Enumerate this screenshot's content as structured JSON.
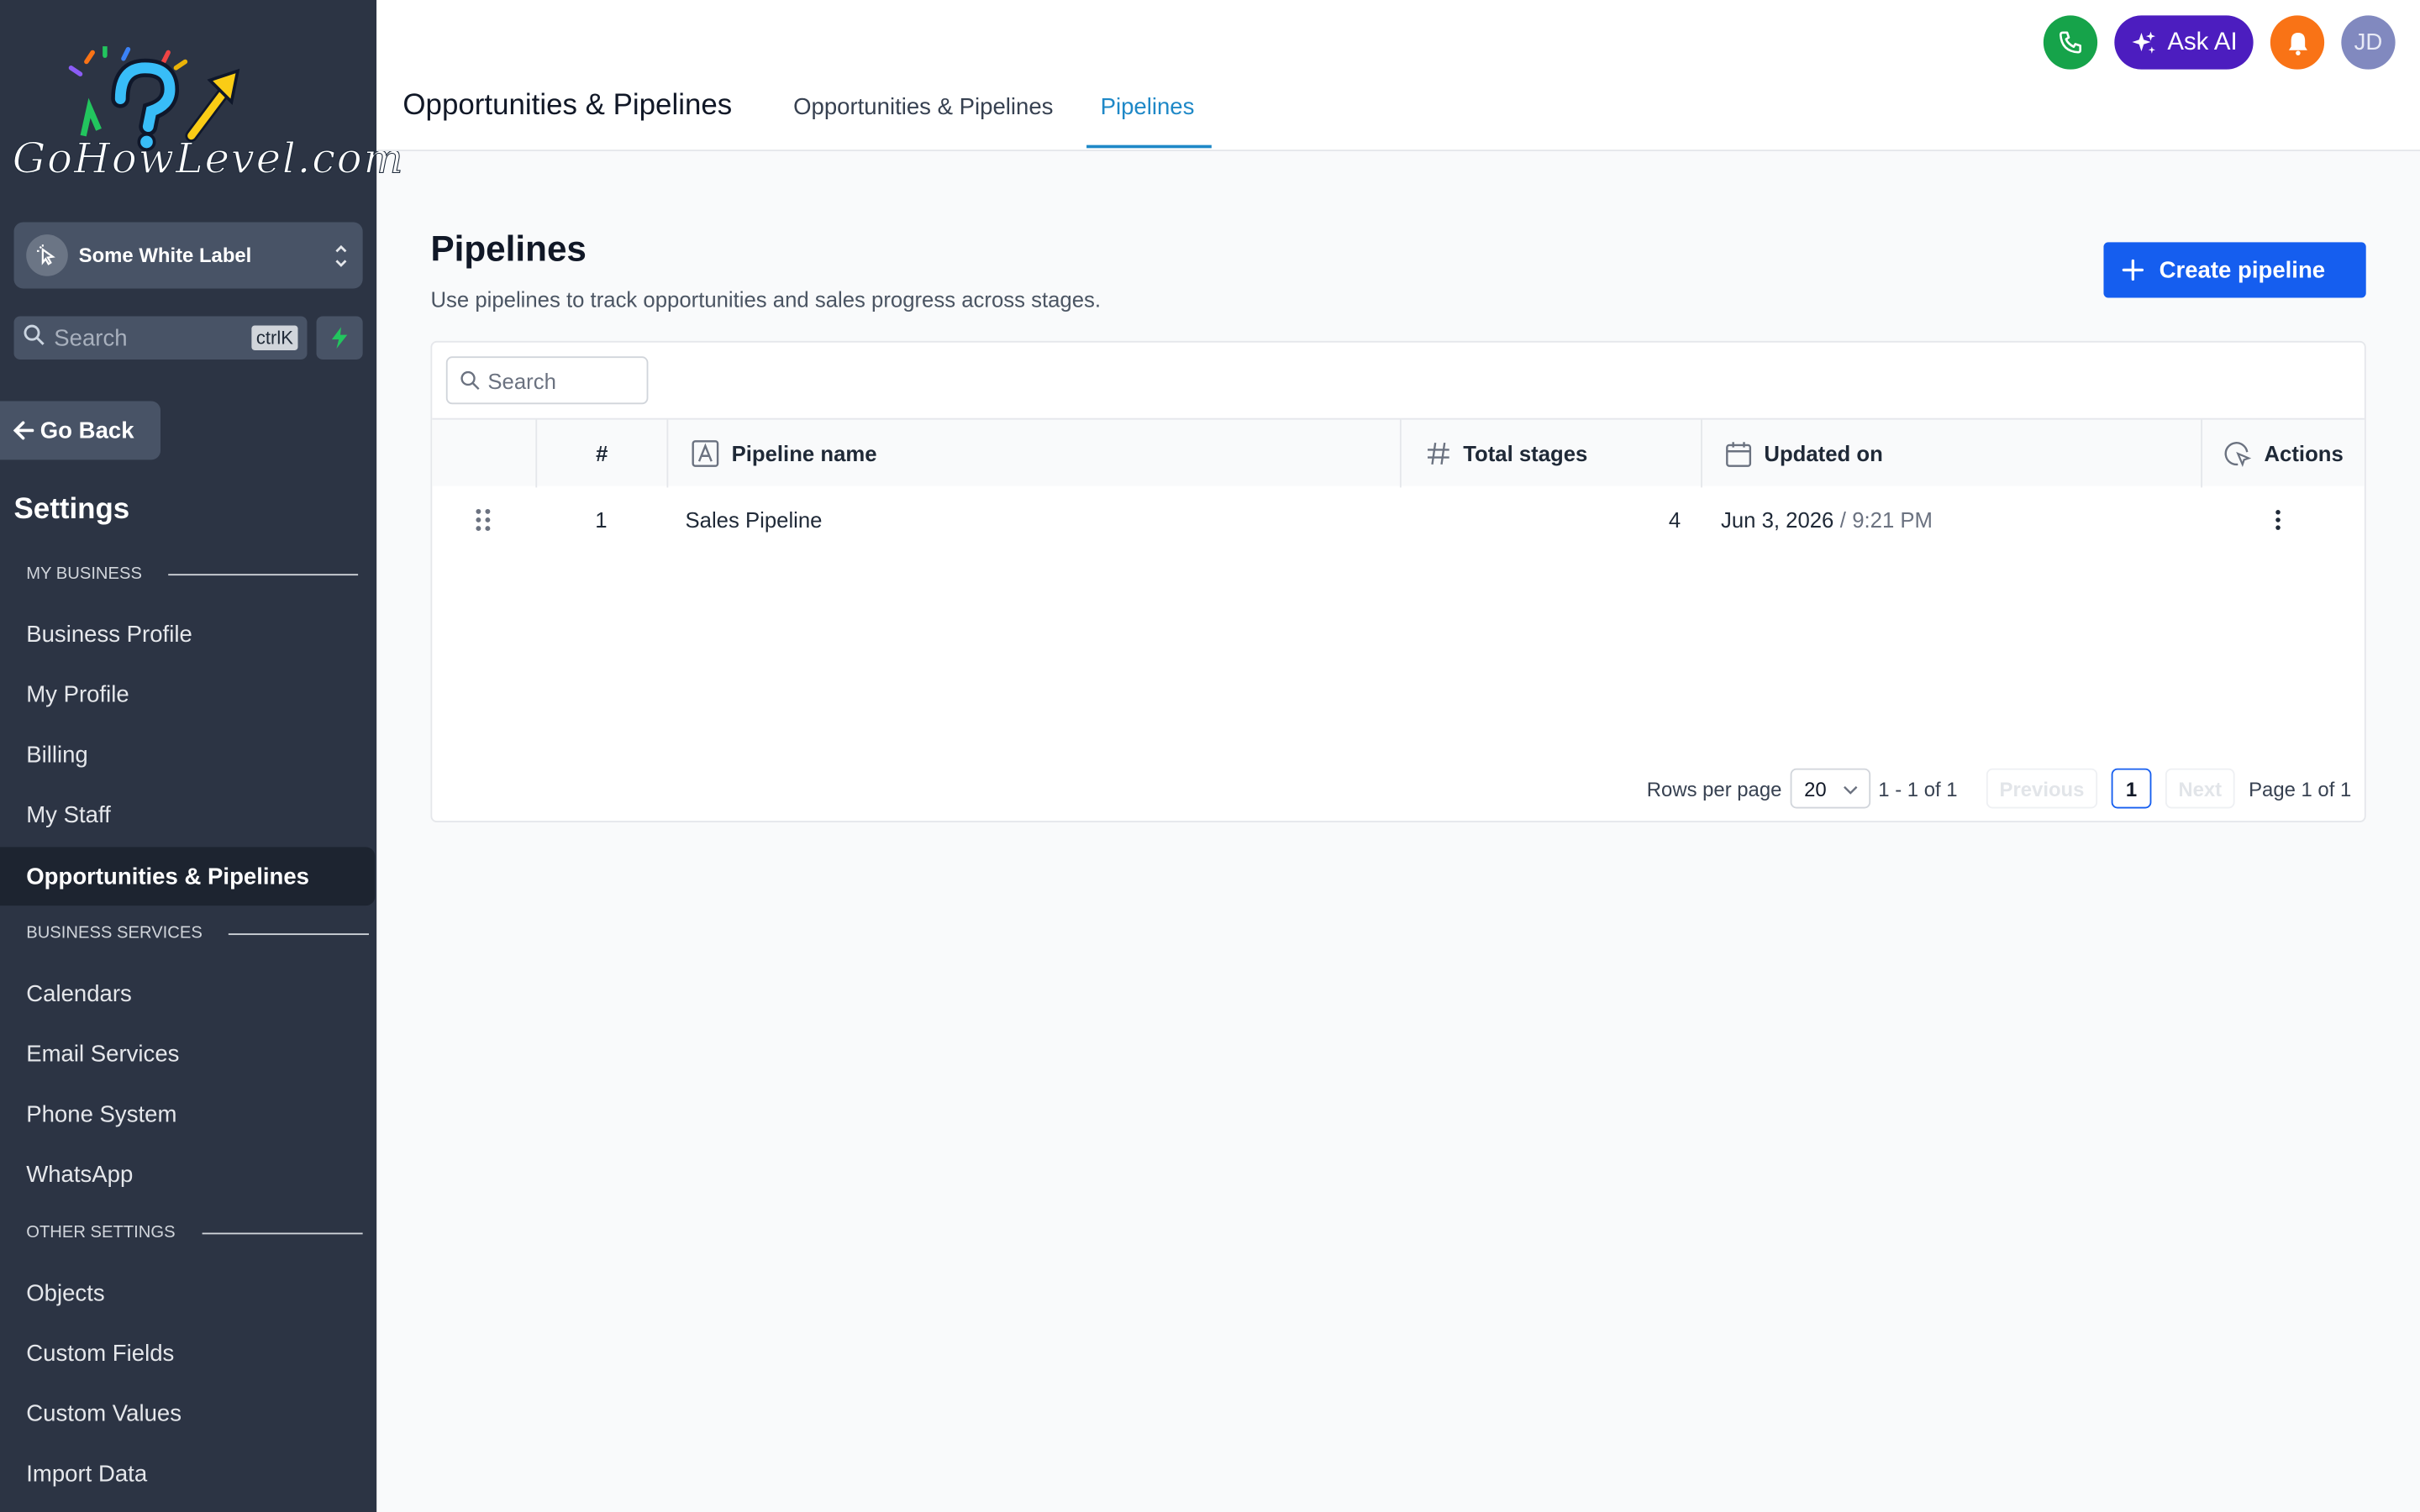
{
  "sidebar": {
    "logo_text": "GoHowLevel.com",
    "account_name": "Some White Label",
    "search_placeholder": "Search",
    "search_shortcut": "ctrlK",
    "go_back": "Go Back",
    "settings_title": "Settings",
    "sections": [
      {
        "header": "MY BUSINESS",
        "items": [
          "Business Profile",
          "My Profile",
          "Billing",
          "My Staff",
          "Opportunities & Pipelines"
        ]
      },
      {
        "header": "BUSINESS SERVICES",
        "items": [
          "Calendars",
          "Email Services",
          "Phone System",
          "WhatsApp"
        ]
      },
      {
        "header": "OTHER SETTINGS",
        "items": [
          "Objects",
          "Custom Fields",
          "Custom Values",
          "Import Data"
        ]
      }
    ],
    "active_item": "Opportunities & Pipelines"
  },
  "header": {
    "title": "Opportunities & Pipelines",
    "tabs": [
      {
        "label": "Opportunities & Pipelines",
        "active": false
      },
      {
        "label": "Pipelines",
        "active": true
      }
    ],
    "ask_ai": "Ask AI",
    "avatar_initials": "JD",
    "icons": [
      "phone-icon",
      "sparkle-icon",
      "bell-icon"
    ]
  },
  "main": {
    "title": "Pipelines",
    "subtitle": "Use pipelines to track opportunities and sales progress across stages.",
    "create_button": "Create pipeline",
    "table": {
      "search_placeholder": "Search",
      "columns": [
        "#",
        "Pipeline name",
        "Total stages",
        "Updated on",
        "Actions"
      ],
      "rows": [
        {
          "index": "1",
          "name": "Sales Pipeline",
          "stages": "4",
          "date": "Jun 3, 2026",
          "separator": "/",
          "time": "9:21 PM"
        }
      ]
    },
    "pagination": {
      "rows_per_page_label": "Rows per page",
      "rows_per_page": "20",
      "range": "1 - 1 of 1",
      "previous": "Previous",
      "current_page": "1",
      "next": "Next",
      "page_of": "Page 1 of 1"
    }
  },
  "colors": {
    "sidebar_bg": "#2c3444",
    "primary": "#155eef",
    "tab_active": "#1e88c7",
    "ask_ai": "#4c1dbf",
    "phone": "#16a34a",
    "bell": "#f97316"
  }
}
